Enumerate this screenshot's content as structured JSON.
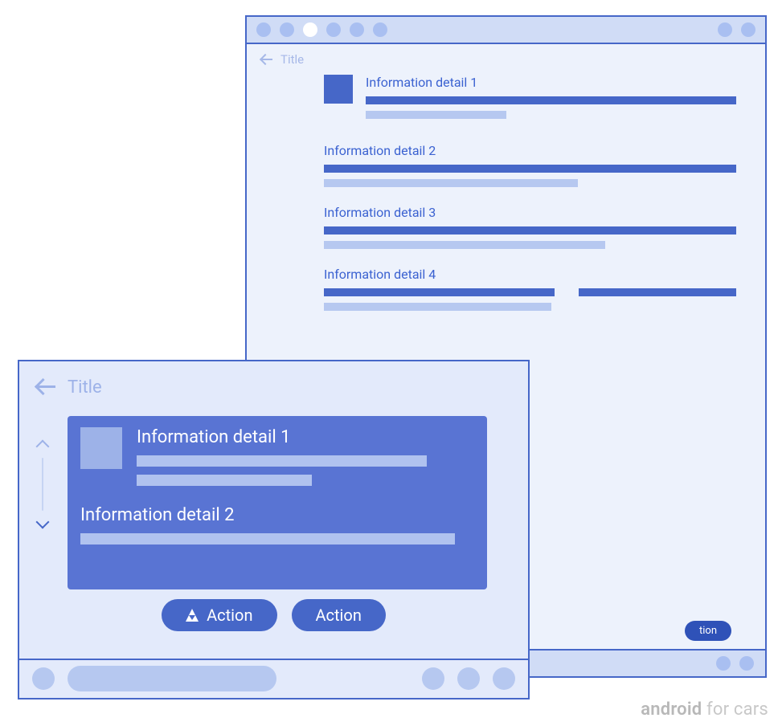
{
  "large": {
    "headerTitle": "Title",
    "items": [
      {
        "label": "Information detail 1"
      },
      {
        "label": "Information detail 2"
      },
      {
        "label": "Information detail 3"
      },
      {
        "label": "Information detail 4"
      }
    ],
    "actionLabelFragment": "tion"
  },
  "small": {
    "headerTitle": "Title",
    "cardItems": [
      {
        "label": "Information detail 1"
      },
      {
        "label": "Information detail 2"
      }
    ],
    "actions": [
      {
        "label": "Action"
      },
      {
        "label": "Action"
      }
    ]
  },
  "branding": {
    "logo": "android",
    "suffix": " for cars"
  }
}
